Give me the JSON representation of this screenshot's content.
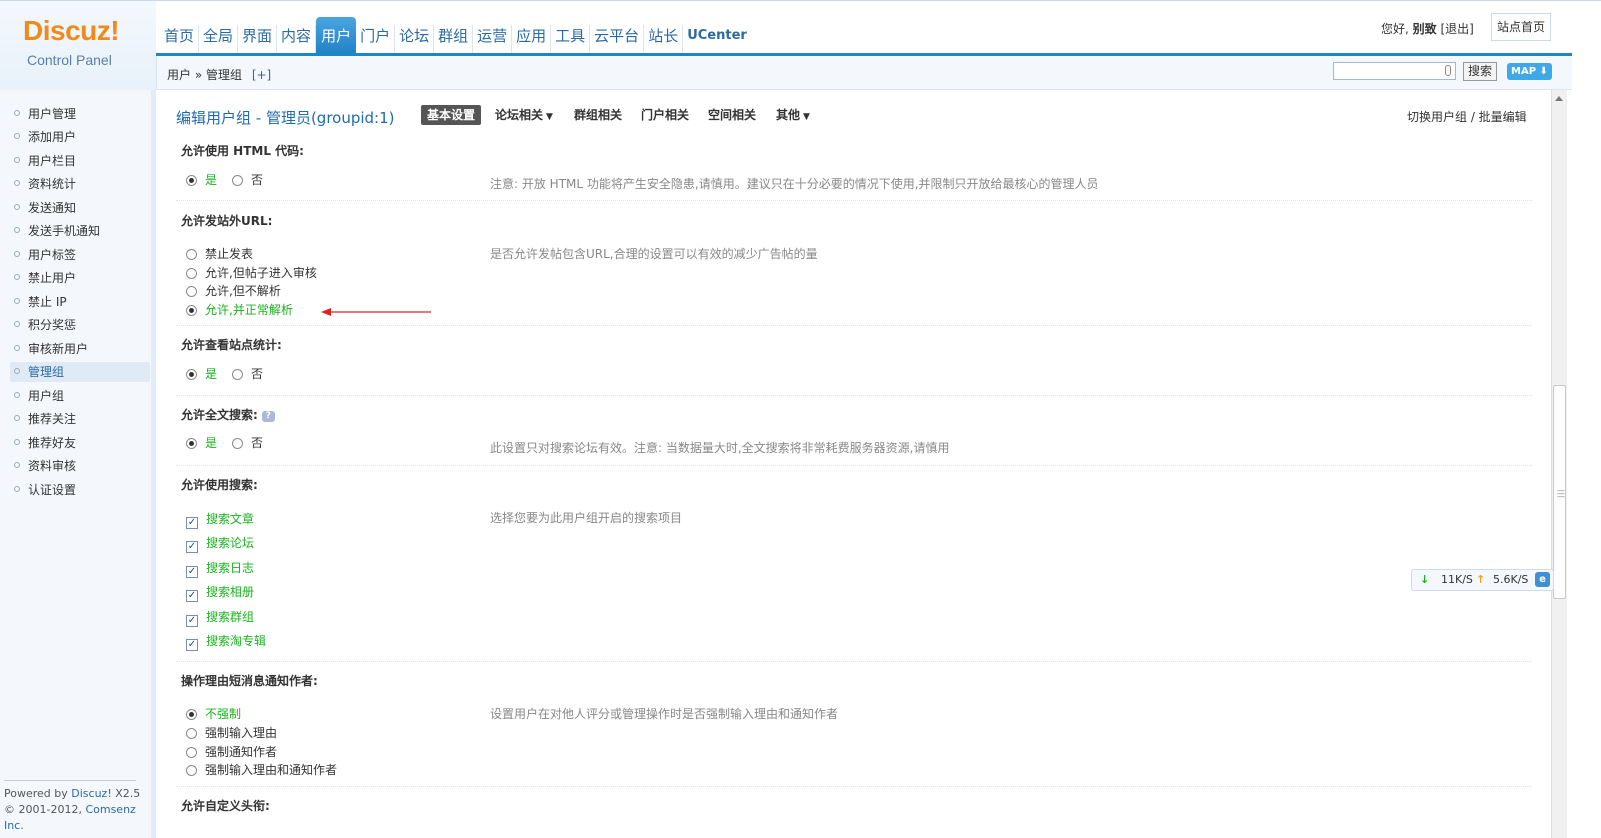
{
  "logo": {
    "brand": "Discuz!",
    "sub": "Control Panel"
  },
  "nav": {
    "items": [
      "首页",
      "全局",
      "界面",
      "内容",
      "用户",
      "门户",
      "论坛",
      "群组",
      "运营",
      "应用",
      "工具",
      "云平台",
      "站长",
      "UCenter"
    ],
    "active_index": 4
  },
  "user_area": {
    "greeting": "您好,",
    "username": "别致",
    "logout": "[退出]",
    "site_home": "站点首页"
  },
  "breadcrumb": {
    "path": "用户 » 管理组",
    "add": "[+]"
  },
  "search": {
    "value": "",
    "button": "搜索",
    "map": "MAP ⬇"
  },
  "sidebar": {
    "items": [
      "用户管理",
      "添加用户",
      "用户栏目",
      "资料统计",
      "发送通知",
      "发送手机通知",
      "用户标签",
      "禁止用户",
      "禁止 IP",
      "积分奖惩",
      "审核新用户",
      "管理组",
      "用户组",
      "推荐关注",
      "推荐好友",
      "资料审核",
      "认证设置"
    ],
    "active_index": 11,
    "powered_line1_prefix": "Powered by ",
    "powered_link": "Discuz!",
    "powered_version": " X2.5",
    "copyright_prefix": "© 2001-2012, ",
    "copyright_link": "Comsenz Inc."
  },
  "main": {
    "title": "编辑用户组 - 管理员(groupid:1)",
    "tabs": [
      "基本设置",
      "论坛相关",
      "群组相关",
      "门户相关",
      "空间相关",
      "其他"
    ],
    "switch_group": "切换用户组 / 批量编辑",
    "sections": {
      "html": {
        "label": "允许使用 HTML 代码:",
        "options": [
          "是",
          "否"
        ],
        "tip": "注意: 开放 HTML 功能将产生安全隐患,请慎用。建议只在十分必要的情况下使用,并限制只开放给最核心的管理人员"
      },
      "url": {
        "label": "允许发站外URL:",
        "options": [
          "禁止发表",
          "允许,但帖子进入审核",
          "允许,但不解析",
          "允许,并正常解析"
        ],
        "tip": "是否允许发帖包含URL,合理的设置可以有效的减少广告帖的量"
      },
      "stats": {
        "label": "允许查看站点统计:",
        "options": [
          "是",
          "否"
        ]
      },
      "fulltext": {
        "label": "允许全文搜索:",
        "help_icon": "help-icon",
        "options": [
          "是",
          "否"
        ],
        "tip": "此设置只对搜索论坛有效。注意: 当数据量大时,全文搜索将非常耗费服务器资源,请慎用"
      },
      "search": {
        "label": "允许使用搜索:",
        "options": [
          "搜索文章",
          "搜索论坛",
          "搜索日志",
          "搜索相册",
          "搜索群组",
          "搜索淘专辑"
        ],
        "tip": "选择您要为此用户组开启的搜索项目"
      },
      "reason": {
        "label": "操作理由短消息通知作者:",
        "options": [
          "不强制",
          "强制输入理由",
          "强制通知作者",
          "强制输入理由和通知作者"
        ],
        "tip": "设置用户在对他人评分或管理操作时是否强制输入理由和通知作者"
      },
      "custom_title": {
        "label": "允许自定义头衔:"
      }
    }
  },
  "speed_widget": {
    "down_arrow": "↓",
    "down": "11K/S",
    "up_arrow": "↑",
    "up": "5.6K/S",
    "icon": "ie-icon"
  },
  "colors": {
    "accent": "#1d86c9",
    "checked_option": "#1ab320",
    "arrow": "#e02020"
  }
}
